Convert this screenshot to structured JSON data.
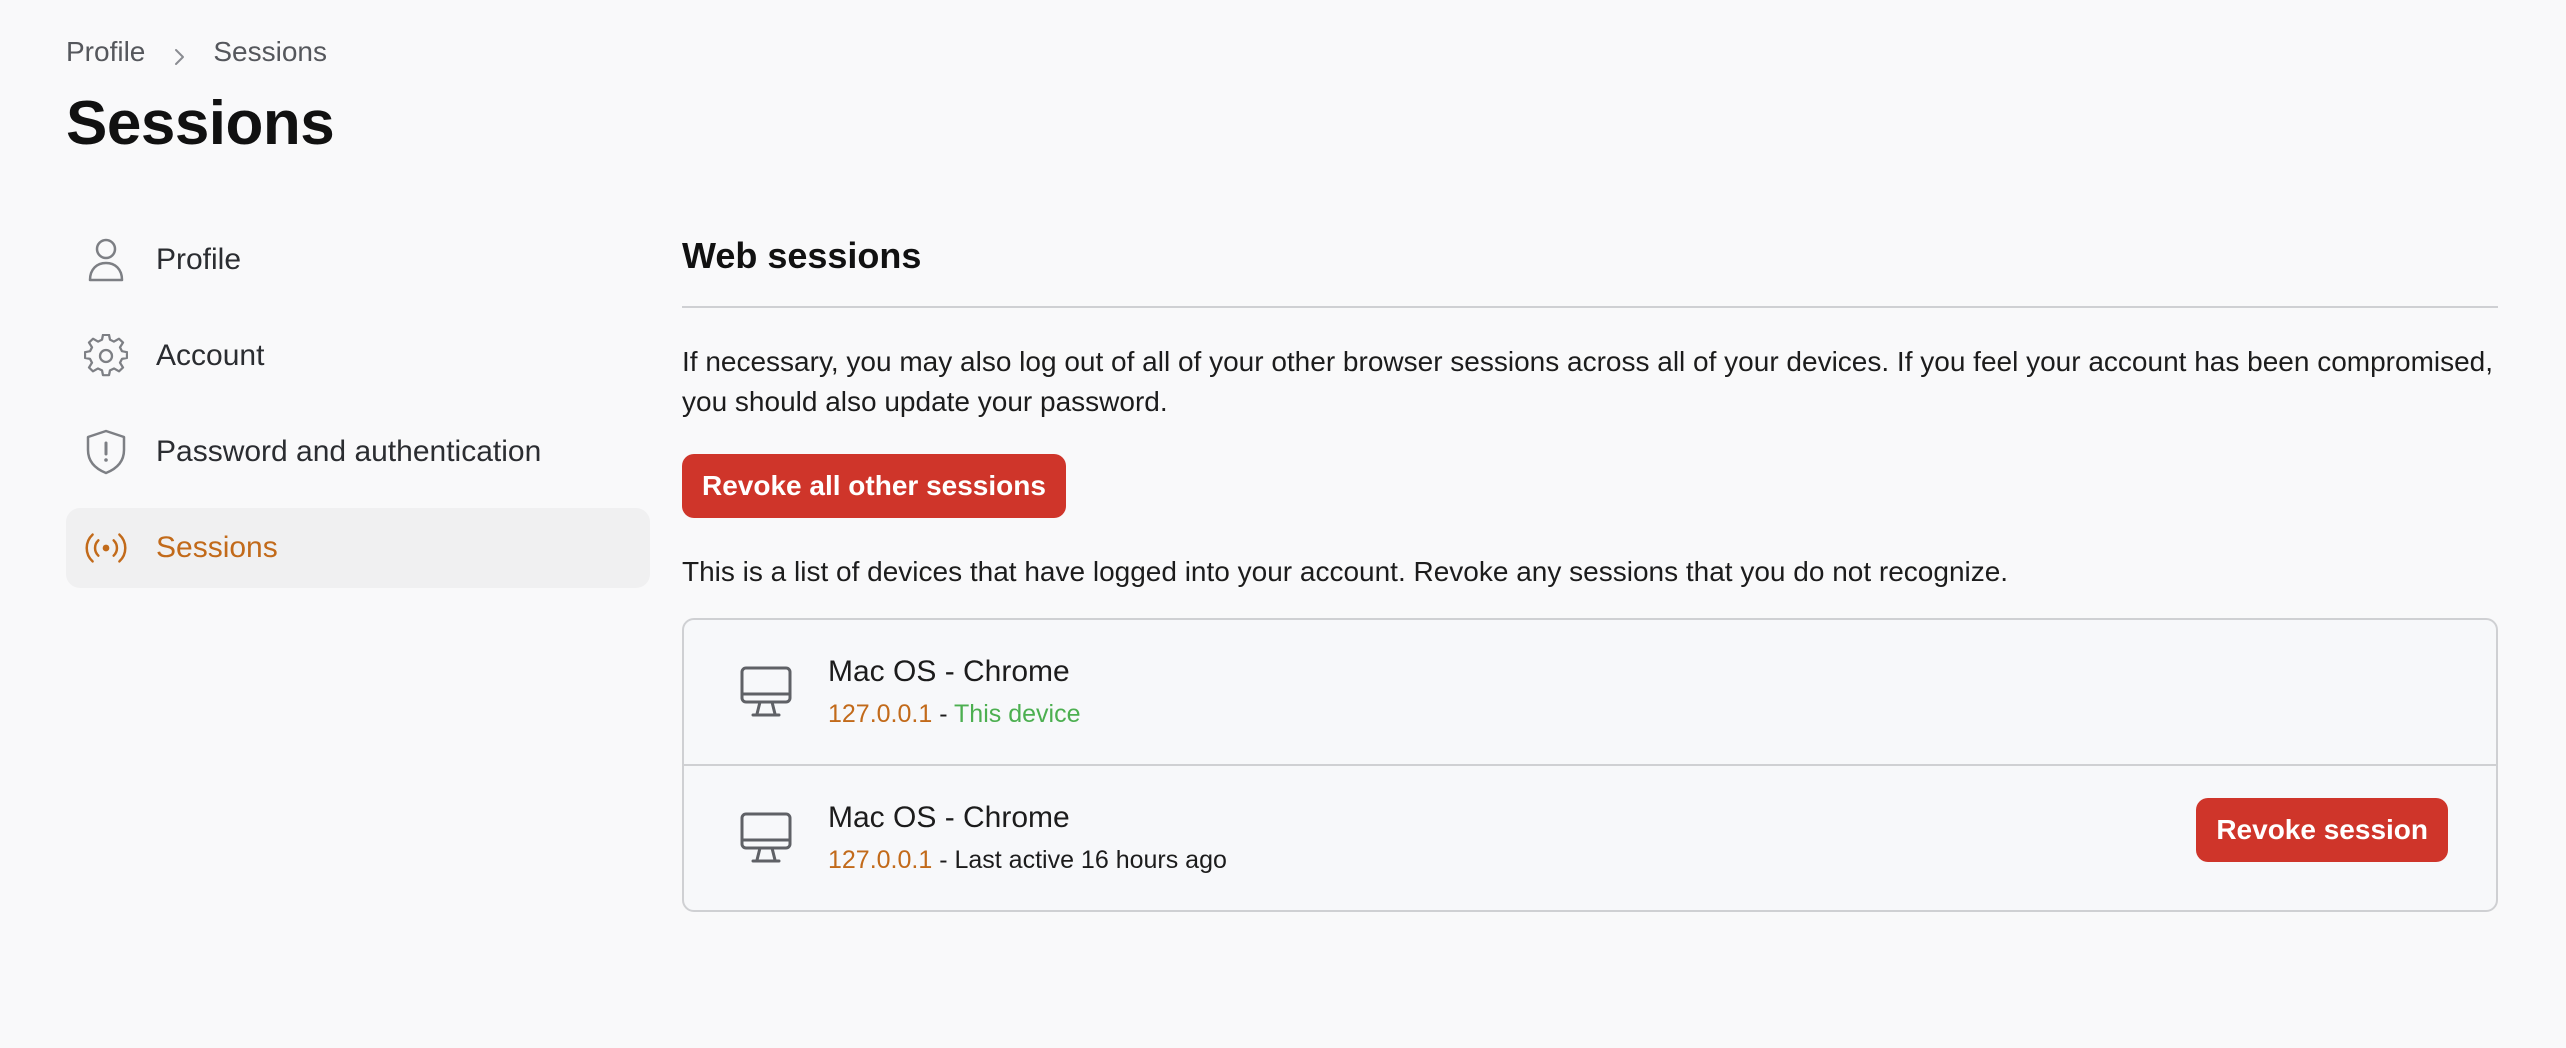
{
  "breadcrumb": {
    "parent": "Profile",
    "current": "Sessions"
  },
  "page_title": "Sessions",
  "sidebar": {
    "items": [
      {
        "label": "Profile",
        "icon": "user-icon",
        "active": false
      },
      {
        "label": "Account",
        "icon": "gear-icon",
        "active": false
      },
      {
        "label": "Password and authentication",
        "icon": "shield-icon",
        "active": false
      },
      {
        "label": "Sessions",
        "icon": "broadcast-icon",
        "active": true
      }
    ]
  },
  "main": {
    "section_title": "Web sessions",
    "description": "If necessary, you may also log out of all of your other browser sessions across all of your devices. If you feel your account has been compromised, you should also update your password.",
    "revoke_all_label": "Revoke all other sessions",
    "list_description": "This is a list of devices that have logged into your account. Revoke any sessions that you do not recognize.",
    "sessions": [
      {
        "device": "Mac OS - Chrome",
        "ip": "127.0.0.1",
        "separator": " - ",
        "status": "This device",
        "current": true
      },
      {
        "device": "Mac OS - Chrome",
        "ip": "127.0.0.1",
        "separator": " - ",
        "status": "Last active 16 hours ago",
        "current": false,
        "revoke_label": "Revoke session"
      }
    ]
  },
  "colors": {
    "accent": "#c26a1a",
    "danger": "#cf352a",
    "success": "#4caf50",
    "background": "#f9f9fa"
  }
}
